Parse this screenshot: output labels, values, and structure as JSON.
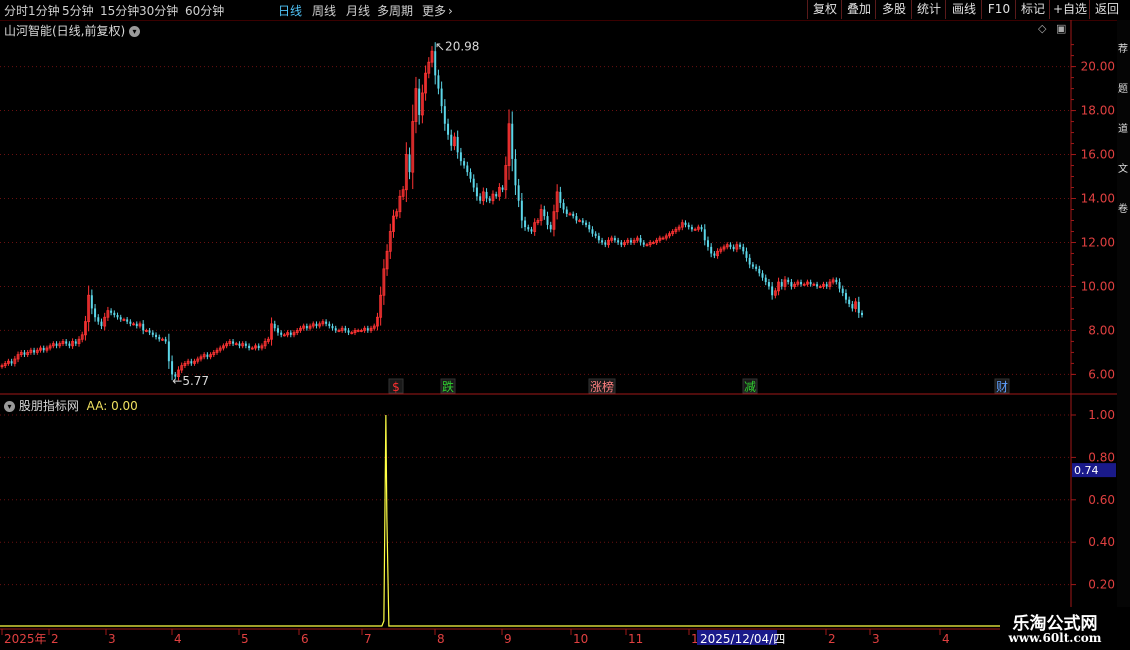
{
  "toolbar": {
    "periods": [
      {
        "label": "分时",
        "active": false
      },
      {
        "label": "1分钟",
        "active": false
      },
      {
        "label": "5分钟",
        "active": false
      },
      {
        "label": "15分钟",
        "active": false
      },
      {
        "label": "30分钟",
        "active": false
      },
      {
        "label": "60分钟",
        "active": false
      },
      {
        "label": "日线",
        "active": true
      },
      {
        "label": "周线",
        "active": false
      },
      {
        "label": "月线",
        "active": false
      },
      {
        "label": "多周期",
        "active": false
      },
      {
        "label": "更多",
        "active": false
      }
    ],
    "more_icon": "chevron-right-icon",
    "buttons": [
      "复权",
      "叠加",
      "多股",
      "统计",
      "画线",
      "F10",
      "标记",
      "+自选",
      "返回"
    ]
  },
  "chart": {
    "title": "山河智能(日线,前复权)",
    "title_icon": "chevron-down-icon",
    "price_axis": [
      "20.00",
      "18.00",
      "16.00",
      "14.00",
      "12.00",
      "10.00",
      "8.00",
      "6.00"
    ],
    "high_label": "20.98",
    "low_label": "5.77",
    "event_markers": [
      {
        "label": "$",
        "color": "#ff3030"
      },
      {
        "label": "跌",
        "color": "#30d030"
      },
      {
        "label": "涨榜",
        "color": "#ff8080"
      },
      {
        "label": "减",
        "color": "#30d030"
      },
      {
        "label": "财",
        "color": "#60a0ff"
      }
    ]
  },
  "indicator": {
    "title": "股朋指标网",
    "aa_label": "AA: 0.00",
    "axis": [
      "1.00",
      "0.80",
      "0.60",
      "0.40",
      "0.20"
    ],
    "current_value": "0.74"
  },
  "date_axis": {
    "labels": [
      "2025年",
      "2",
      "3",
      "4",
      "5",
      "6",
      "7",
      "8",
      "9",
      "10",
      "11",
      "1",
      "2",
      "3",
      "4"
    ],
    "cursor_date": "2025/12/04/四"
  },
  "watermark": {
    "title": "乐淘公式网",
    "url": "www.60lt.com"
  },
  "side_strip": [
    "荐",
    "题",
    "道",
    "文",
    "卷"
  ],
  "chart_data": {
    "type": "candlestick",
    "price_range": [
      5.2,
      21.3
    ],
    "closes": [
      6.4,
      6.5,
      6.6,
      6.5,
      6.7,
      6.9,
      7.0,
      6.9,
      7.0,
      7.1,
      7.0,
      7.1,
      7.2,
      7.1,
      7.2,
      7.3,
      7.4,
      7.3,
      7.4,
      7.5,
      7.4,
      7.3,
      7.5,
      7.4,
      7.6,
      7.8,
      8.4,
      9.6,
      9.0,
      8.6,
      8.4,
      8.2,
      8.6,
      8.9,
      8.8,
      8.7,
      8.6,
      8.5,
      8.5,
      8.4,
      8.3,
      8.3,
      8.2,
      8.3,
      8.0,
      8.0,
      7.9,
      7.8,
      7.7,
      7.6,
      7.6,
      7.5,
      6.6,
      6.0,
      5.9,
      6.2,
      6.4,
      6.5,
      6.6,
      6.5,
      6.6,
      6.7,
      6.8,
      6.9,
      6.8,
      6.9,
      7.0,
      7.1,
      7.2,
      7.3,
      7.4,
      7.5,
      7.4,
      7.4,
      7.3,
      7.4,
      7.3,
      7.2,
      7.2,
      7.3,
      7.2,
      7.3,
      7.5,
      7.6,
      8.3,
      8.1,
      7.9,
      7.8,
      7.8,
      7.9,
      7.8,
      7.9,
      8.0,
      8.1,
      8.2,
      8.1,
      8.2,
      8.3,
      8.2,
      8.3,
      8.4,
      8.3,
      8.2,
      8.1,
      8.0,
      8.0,
      8.1,
      8.0,
      7.9,
      7.9,
      8.0,
      8.0,
      8.0,
      8.1,
      8.0,
      8.1,
      8.2,
      8.6,
      9.6,
      10.8,
      11.6,
      12.5,
      13.2,
      13.4,
      14.1,
      14.4,
      16.0,
      15.2,
      17.5,
      19.0,
      17.8,
      18.8,
      19.7,
      20.2,
      20.7,
      19.6,
      19.0,
      18.2,
      17.4,
      16.9,
      16.4,
      16.8,
      16.1,
      15.7,
      15.5,
      15.2,
      14.9,
      14.5,
      14.1,
      13.9,
      14.3,
      14.0,
      13.9,
      14.2,
      14.1,
      14.5,
      14.4,
      15.5,
      17.4,
      15.8,
      14.6,
      13.9,
      13.0,
      12.7,
      12.6,
      12.5,
      12.9,
      13.0,
      13.5,
      13.2,
      12.8,
      12.6,
      13.4,
      14.3,
      13.8,
      13.5,
      13.3,
      13.3,
      13.2,
      13.0,
      13.0,
      12.9,
      12.8,
      12.6,
      12.4,
      12.3,
      12.1,
      12.0,
      11.9,
      12.1,
      12.2,
      12.1,
      12.0,
      11.9,
      12.0,
      12.1,
      12.0,
      12.1,
      12.2,
      12.0,
      11.9,
      11.9,
      12.0,
      12.0,
      12.1,
      12.2,
      12.2,
      12.3,
      12.4,
      12.5,
      12.6,
      12.7,
      12.9,
      12.8,
      12.7,
      12.6,
      12.6,
      12.7,
      12.6,
      12.1,
      11.8,
      11.5,
      11.4,
      11.6,
      11.7,
      11.8,
      11.9,
      11.8,
      11.7,
      11.9,
      11.8,
      11.6,
      11.3,
      11.0,
      10.9,
      10.8,
      10.6,
      10.4,
      10.2,
      10.0,
      9.6,
      9.8,
      10.2,
      10.0,
      10.3,
      10.2,
      10.0,
      10.1,
      10.2,
      10.1,
      10.1,
      10.2,
      10.1,
      10.1,
      10.0,
      10.0,
      10.1,
      10.0,
      10.2,
      10.3,
      10.2,
      9.9,
      9.7,
      9.4,
      9.2,
      9.0,
      9.3,
      8.8,
      8.7
    ]
  }
}
